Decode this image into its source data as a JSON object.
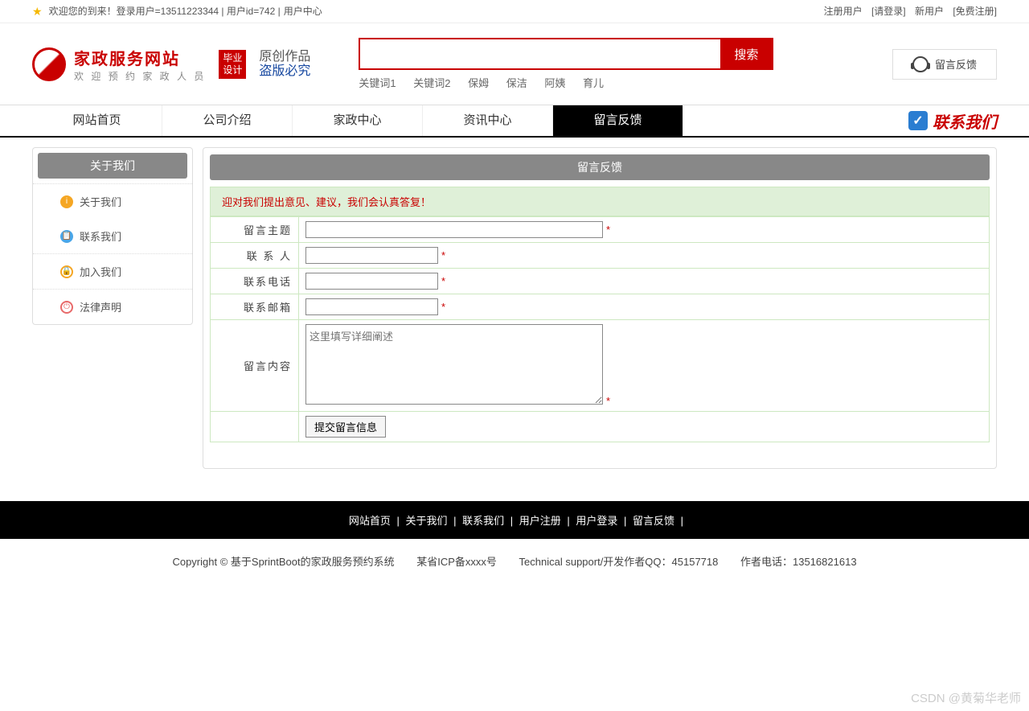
{
  "topbar": {
    "welcome": "欢迎您的到来！登录用户=13511223344 | 用户id=742 | ",
    "user_center": "用户中心",
    "reg_label": "注册用户",
    "login_link": "[请登录]",
    "new_label": "新用户",
    "free_reg": "[免费注册]"
  },
  "logo": {
    "title": "家政服务网站",
    "sub": "欢 迎 预 约 家 政 人 员",
    "bishe": "毕业设计",
    "calli1": "原创作品",
    "calli2": "盗版必究"
  },
  "search": {
    "button": "搜索",
    "keywords": [
      "关键词1",
      "关键词2",
      "保姆",
      "保洁",
      "阿姨",
      "育儿"
    ]
  },
  "feedback_btn": "留言反馈",
  "nav": {
    "items": [
      "网站首页",
      "公司介绍",
      "家政中心",
      "资讯中心",
      "留言反馈"
    ],
    "active": 4,
    "contact": "联系我们"
  },
  "sidebar": {
    "head": "关于我们",
    "items": [
      "关于我们",
      "联系我们",
      "加入我们",
      "法律声明"
    ]
  },
  "panel": {
    "head": "留言反馈",
    "tip": "迎对我们提出意见、建议，我们会认真答复！"
  },
  "form": {
    "subject": "留言主题",
    "contact": "联 系 人",
    "phone": "联系电话",
    "email": "联系邮箱",
    "content": "留言内容",
    "placeholder": "这里填写详细阐述",
    "submit": "提交留言信息"
  },
  "footer": {
    "links": [
      "网站首页",
      "关于我们",
      "联系我们",
      "用户注册",
      "用户登录",
      "留言反馈"
    ],
    "copy": "Copyright © 基于SprintBoot的家政服务预约系统",
    "icp": "某省ICP备xxxx号",
    "qq": "Technical support/开发作者QQ：45157718",
    "tel": "作者电话：13516821613"
  },
  "watermark": "CSDN @黄菊华老师"
}
